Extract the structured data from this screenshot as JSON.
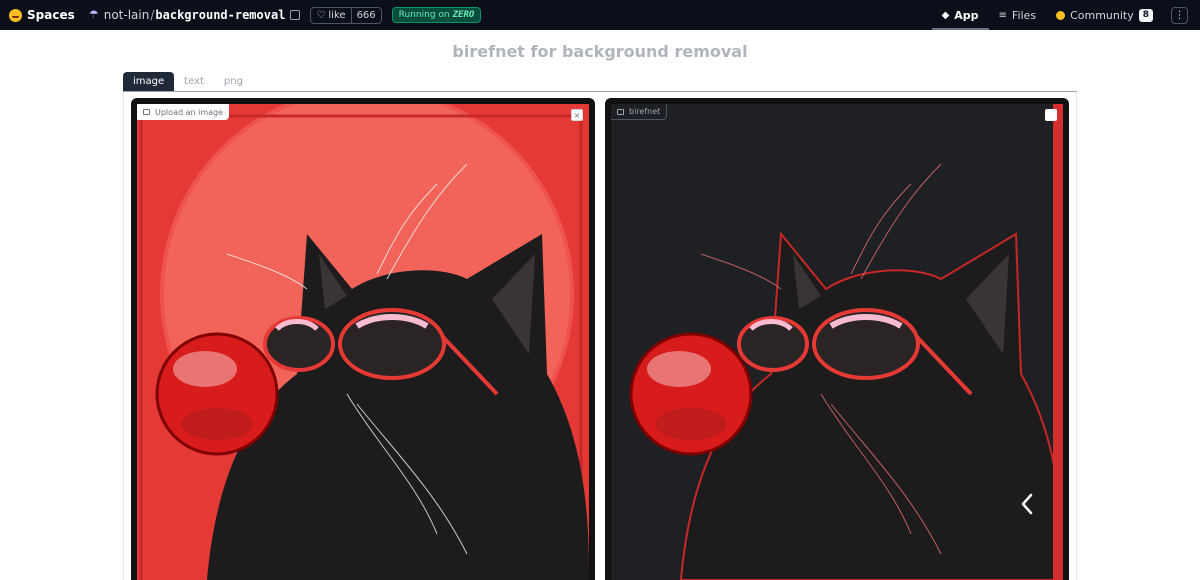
{
  "topbar": {
    "spaces_label": "Spaces",
    "owner": "not-lain",
    "slash": "/",
    "repo": "background-removal",
    "like_label": "like",
    "like_count": "666",
    "running_prefix": "Running on",
    "running_hw": "ZERO",
    "nav": [
      {
        "label": "App",
        "icon": "app-icon"
      },
      {
        "label": "Files",
        "icon": "files-icon"
      },
      {
        "label": "Community",
        "icon": "community-icon",
        "count": "8"
      }
    ]
  },
  "title": "birefnet for background removal",
  "tabs": [
    {
      "label": "image",
      "active": true
    },
    {
      "label": "text",
      "active": false
    },
    {
      "label": "png",
      "active": false
    }
  ],
  "input_panel": {
    "label": "Upload an image",
    "close_symbol": "×"
  },
  "output_panel": {
    "label": "birefnet"
  },
  "colors": {
    "accent_red": "#e53935",
    "topbar_bg": "#0b0f19",
    "running_badge": "#059669",
    "output_bg": "#1f2023"
  }
}
